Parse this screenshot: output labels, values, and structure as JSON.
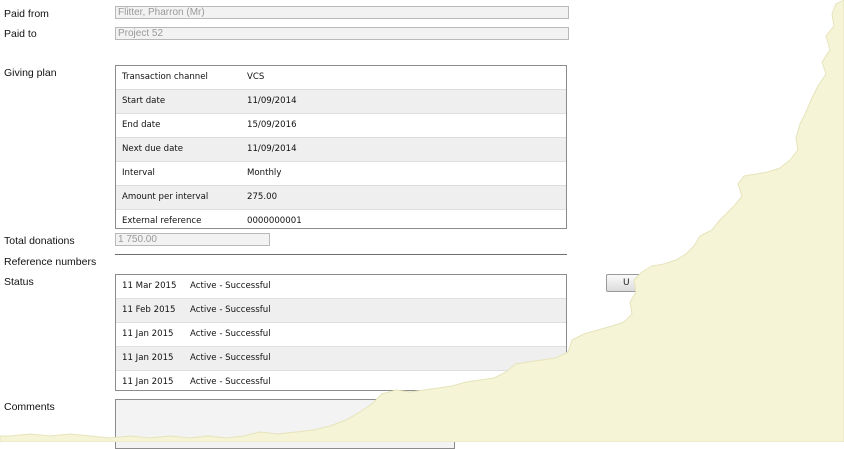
{
  "labels": {
    "paid_from": "Paid from",
    "paid_to": "Paid to",
    "giving_plan": "Giving plan",
    "total_donations": "Total donations",
    "reference_numbers": "Reference numbers",
    "status": "Status",
    "comments": "Comments"
  },
  "fields": {
    "paid_from": "Flitter, Pharron (Mr)",
    "paid_to": "Project 52",
    "total_donations": "1 750.00"
  },
  "giving_plan": [
    {
      "label": "Transaction channel",
      "value": "VCS"
    },
    {
      "label": "Start date",
      "value": "11/09/2014"
    },
    {
      "label": "End date",
      "value": "15/09/2016"
    },
    {
      "label": "Next due date",
      "value": "11/09/2014"
    },
    {
      "label": "Interval",
      "value": "Monthly"
    },
    {
      "label": "Amount per interval",
      "value": "275.00"
    },
    {
      "label": "External reference",
      "value": "0000000001"
    }
  ],
  "status_history": [
    {
      "date": "11 Mar 2015",
      "status": "Active - Successful"
    },
    {
      "date": "11 Feb 2015",
      "status": "Active - Successful"
    },
    {
      "date": "11 Jan 2015",
      "status": "Active - Successful"
    },
    {
      "date": "11 Jan 2015",
      "status": "Active - Successful"
    },
    {
      "date": "11 Jan 2015",
      "status": "Active - Successful"
    }
  ],
  "buttons": {
    "update_partial": "U"
  },
  "colors": {
    "torn_overlay": "#f5f4d6",
    "panel_border": "#8c8c8c",
    "alt_row": "#efefef"
  }
}
